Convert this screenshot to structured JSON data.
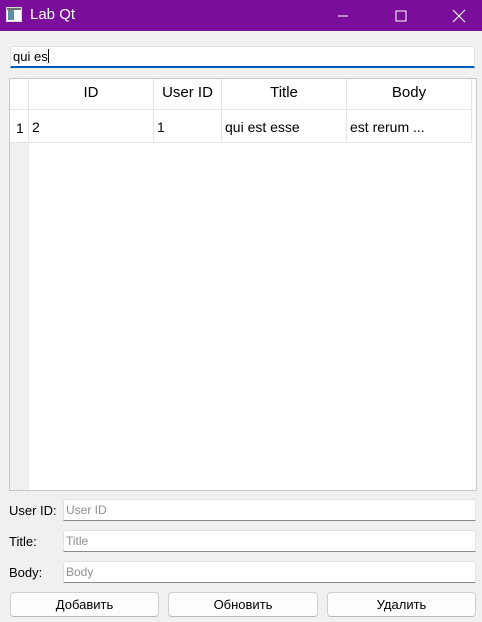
{
  "window": {
    "title": "Lab Qt",
    "accent_color": "#7a0e9a",
    "icons": [
      "app-icon",
      "minimize-icon",
      "maximize-icon",
      "close-icon"
    ]
  },
  "search": {
    "value": "qui es"
  },
  "table": {
    "columns": [
      "ID",
      "User ID",
      "Title",
      "Body"
    ],
    "rows": [
      {
        "row_header": "1",
        "id": "2",
        "user_id": "1",
        "title": "qui est esse",
        "body": "est rerum ..."
      }
    ]
  },
  "form": {
    "user_id_label": "User ID:",
    "user_id_placeholder": "User ID",
    "title_label": "Title:",
    "title_placeholder": "Title",
    "body_label": "Body:",
    "body_placeholder": "Body"
  },
  "buttons": {
    "add_label": "Добавить",
    "update_label": "Обновить",
    "delete_label": "Удалить"
  }
}
